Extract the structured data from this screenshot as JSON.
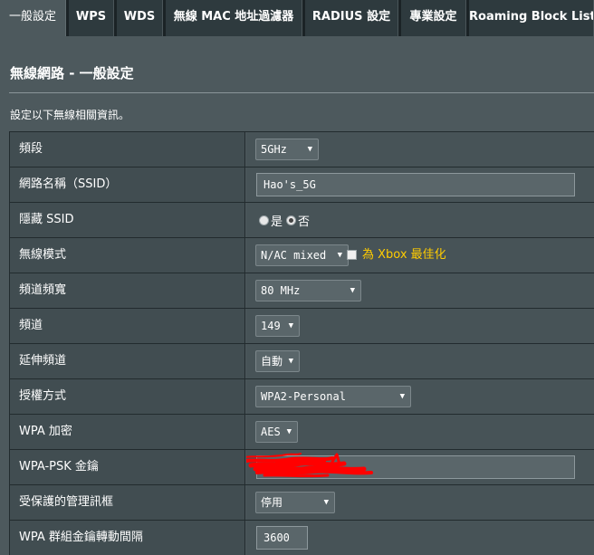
{
  "tabs": [
    {
      "label": "一般設定",
      "active": true
    },
    {
      "label": "WPS",
      "active": false
    },
    {
      "label": "WDS",
      "active": false
    },
    {
      "label": "無線 MAC 地址過濾器",
      "active": false
    },
    {
      "label": "RADIUS 設定",
      "active": false
    },
    {
      "label": "專業設定",
      "active": false
    },
    {
      "label": "Roaming Block List",
      "active": false
    }
  ],
  "page": {
    "title": "無線網路 - 一般設定",
    "description": "設定以下無線相關資訊。"
  },
  "settings": {
    "band": {
      "label": "頻段",
      "value": "5GHz"
    },
    "ssid": {
      "label": "網路名稱（SSID）",
      "value": "Hao's_5G"
    },
    "hide_ssid": {
      "label": "隱藏 SSID",
      "yes": "是",
      "no": "否",
      "selected": "no"
    },
    "wireless_mode": {
      "label": "無線模式",
      "value": "N/AC mixed",
      "xbox_label": "為 Xbox 最佳化",
      "xbox_checked": false
    },
    "channel_bandwidth": {
      "label": "頻道頻寬",
      "value": "80 MHz"
    },
    "channel": {
      "label": "頻道",
      "value": "149"
    },
    "extension_channel": {
      "label": "延伸頻道",
      "value": "自動"
    },
    "auth_method": {
      "label": "授權方式",
      "value": "WPA2-Personal"
    },
    "wpa_encryption": {
      "label": "WPA 加密",
      "value": "AES"
    },
    "wpa_psk": {
      "label": "WPA-PSK 金鑰",
      "value": ""
    },
    "pmf": {
      "label": "受保護的管理訊框",
      "value": "停用"
    },
    "group_key_interval": {
      "label": "WPA 群組金鑰轉動間隔",
      "value": "3600"
    }
  },
  "colors": {
    "background": "#4d595d",
    "label_cell": "#414d51",
    "tab_bar": "#1b2326",
    "highlight": "#ffcc00",
    "redaction": "#ff0000"
  }
}
